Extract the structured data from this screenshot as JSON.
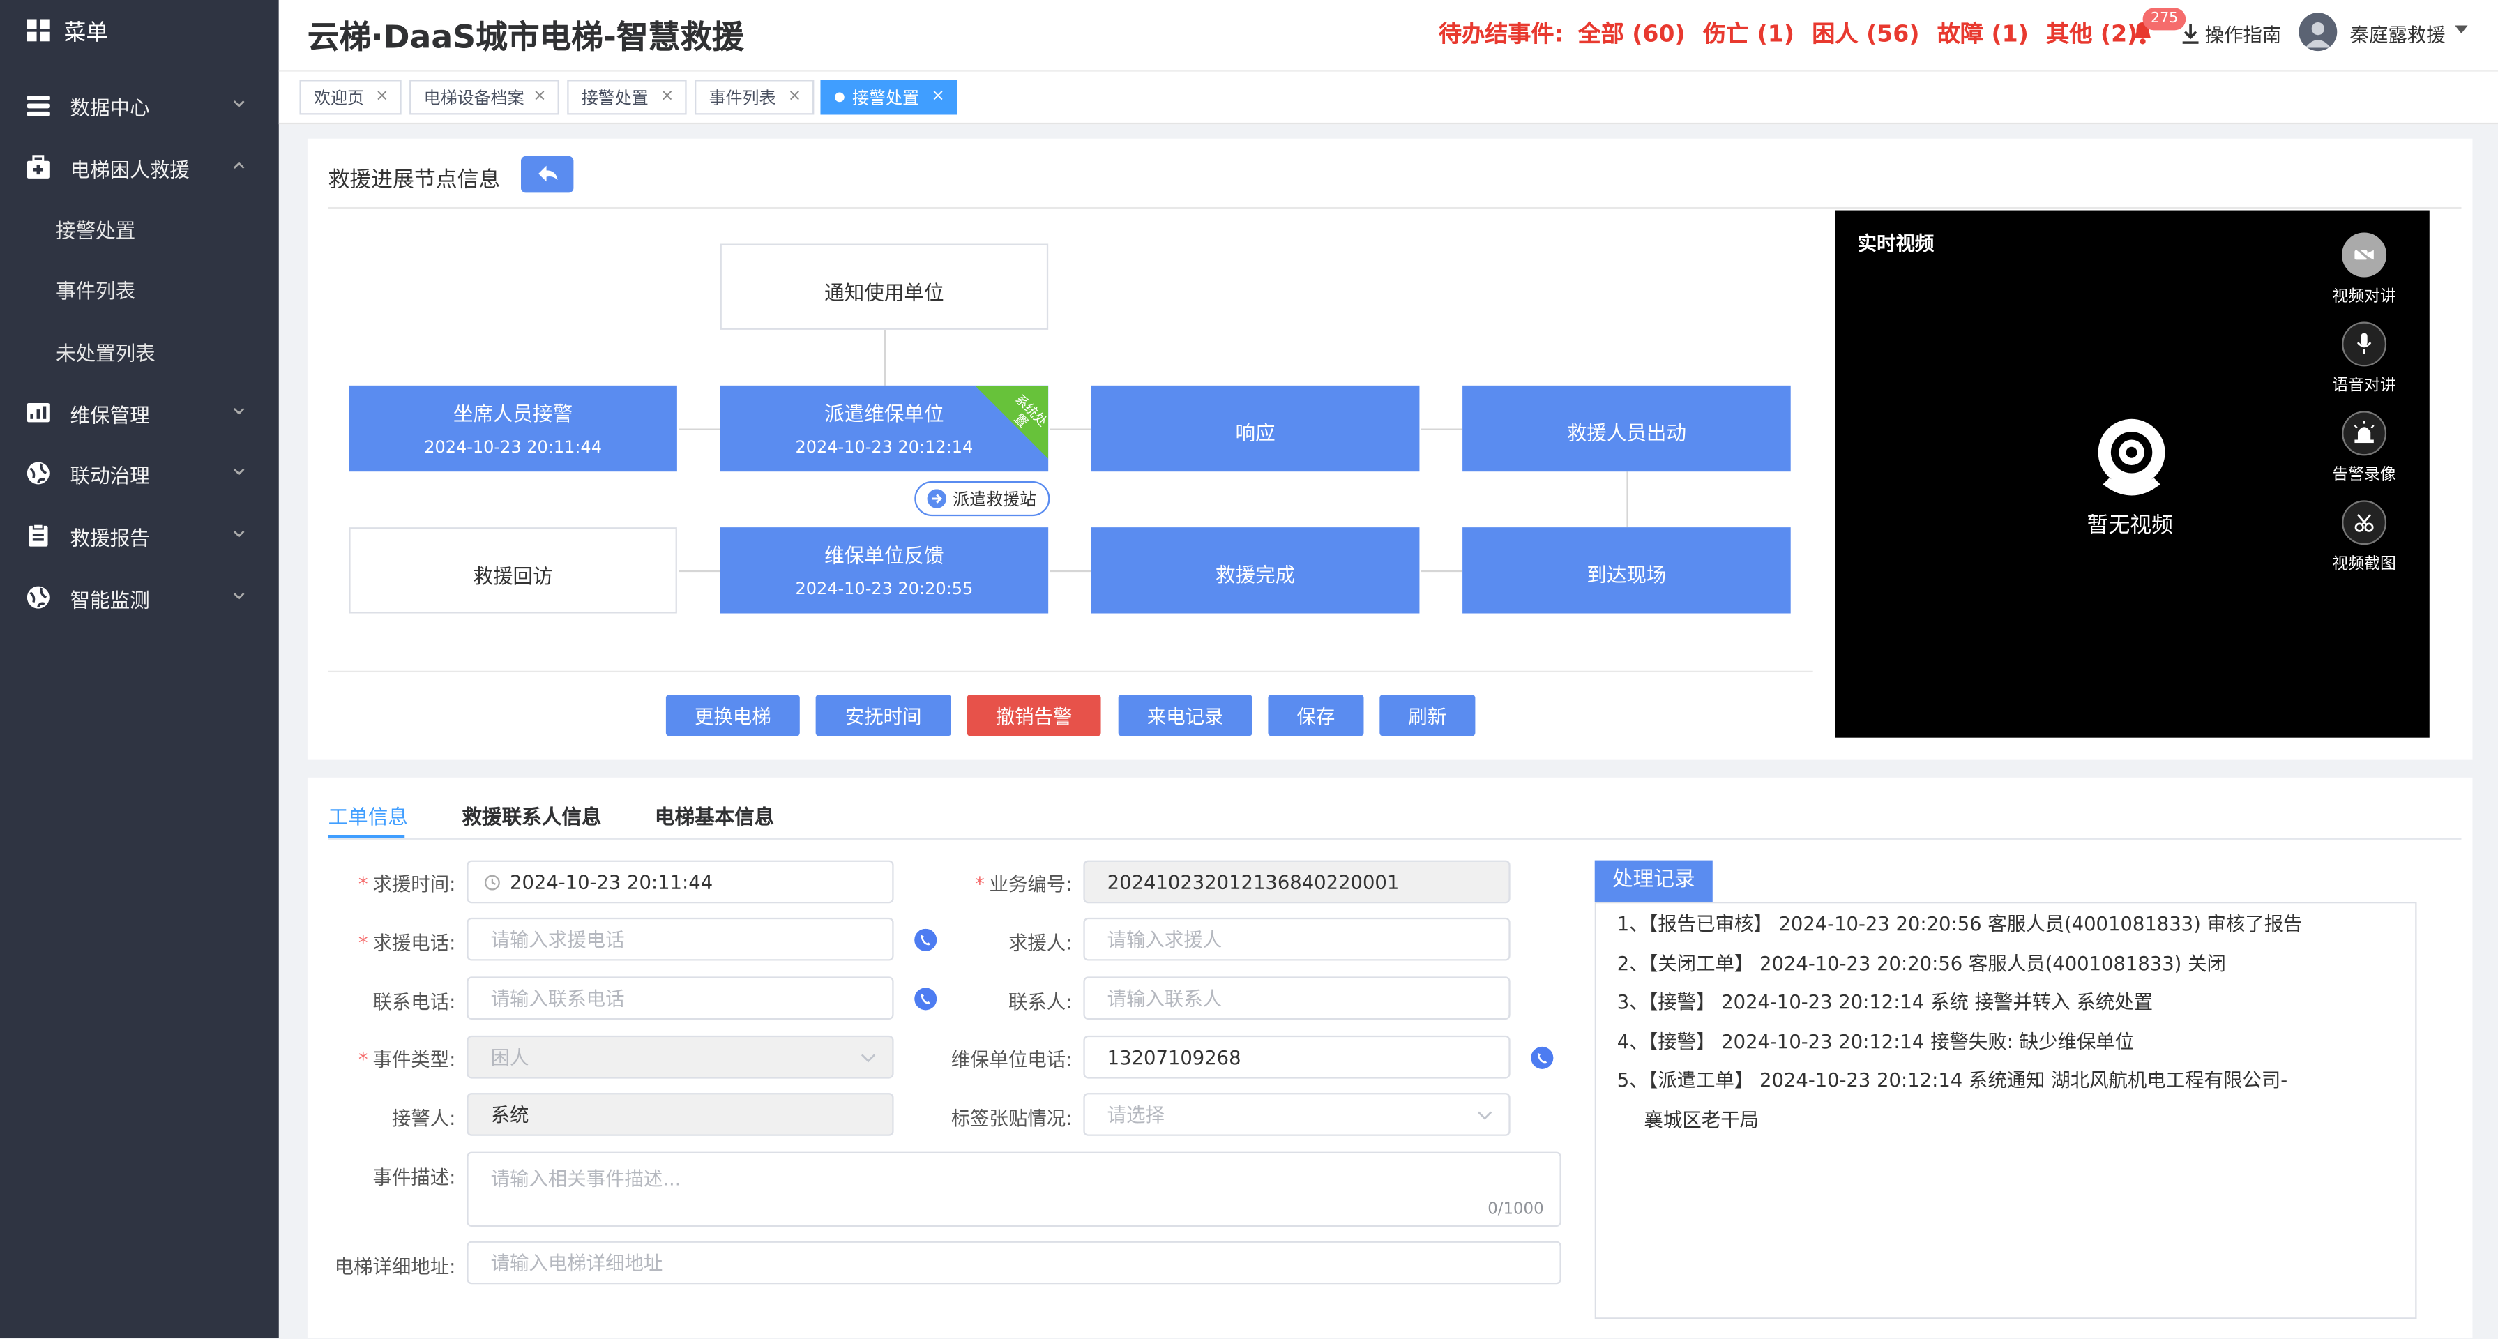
{
  "sidebar": {
    "title": "菜单",
    "items": [
      {
        "label": "数据中心",
        "icon": "database-icon"
      },
      {
        "label": "电梯困人救援",
        "icon": "medkit-icon",
        "children": [
          "接警处置",
          "事件列表",
          "未处置列表"
        ]
      },
      {
        "label": "维保管理",
        "icon": "maintenance-icon"
      },
      {
        "label": "联动治理",
        "icon": "globe-icon"
      },
      {
        "label": "救援报告",
        "icon": "report-icon"
      },
      {
        "label": "智能监测",
        "icon": "monitor-icon"
      }
    ]
  },
  "header": {
    "title": "云梯·DaaS城市电梯-智慧救援",
    "pending_label": "待办结事件:",
    "pending": [
      "全部 (60)",
      "伤亡 (1)",
      "困人 (56)",
      "故障 (1)",
      "其他 (2)"
    ],
    "bell_count": "275",
    "guide": "操作指南",
    "user": "秦庭露救援"
  },
  "tabs": [
    {
      "label": "欢迎页"
    },
    {
      "label": "电梯设备档案"
    },
    {
      "label": "接警处置"
    },
    {
      "label": "事件列表"
    },
    {
      "label": "接警处置",
      "active": true
    }
  ],
  "progress": {
    "title": "救援进展节点信息",
    "nodes": {
      "notify": {
        "label": "通知使用单位"
      },
      "seat": {
        "label": "坐席人员接警",
        "time": "2024-10-23 20:11:44"
      },
      "dispatch": {
        "label": "派遣维保单位",
        "time": "2024-10-23 20:12:14",
        "corner": "系统处置"
      },
      "respond": {
        "label": "响应"
      },
      "depart": {
        "label": "救援人员出动"
      },
      "revisit": {
        "label": "救援回访"
      },
      "feedback": {
        "label": "维保单位反馈",
        "time": "2024-10-23 20:20:55"
      },
      "complete": {
        "label": "救援完成"
      },
      "arrive": {
        "label": "到达现场"
      }
    },
    "dispatch_station": "派遣救援站"
  },
  "actions": [
    "更换电梯",
    "安抚时间",
    "撤销告警",
    "来电记录",
    "保存",
    "刷新"
  ],
  "video": {
    "title": "实时视频",
    "no_video": "暂无视频",
    "controls": [
      "视频对讲",
      "语音对讲",
      "告警录像",
      "视频截图"
    ]
  },
  "bottom_tabs": [
    "工单信息",
    "救援联系人信息",
    "电梯基本信息"
  ],
  "form": {
    "request_time": {
      "label": "求援时间:",
      "value": "2024-10-23 20:11:44"
    },
    "business_no": {
      "label": "业务编号:",
      "value": "20241023201213684022000​1"
    },
    "request_phone": {
      "label": "求援电话:",
      "placeholder": "请输入求援电话"
    },
    "requester": {
      "label": "求援人:",
      "placeholder": "请输入求援人"
    },
    "contact_phone": {
      "label": "联系电话:",
      "placeholder": "请输入联系电话"
    },
    "contact": {
      "label": "联系人:",
      "placeholder": "请输入联系人"
    },
    "event_type": {
      "label": "事件类型:",
      "value": "困人"
    },
    "maint_phone": {
      "label": "维保单位电话:",
      "value": "13207109268"
    },
    "receiver": {
      "label": "接警人:",
      "value": "系统"
    },
    "label_status": {
      "label": "标签张贴情况:",
      "placeholder": "请选择"
    },
    "description": {
      "label": "事件描述:",
      "placeholder": "请输入相关事件描述...",
      "counter": "0/1000"
    },
    "address": {
      "label": "电梯详细地址:",
      "placeholder": "请输入电梯详细地址"
    }
  },
  "records": {
    "title": "处理记录",
    "items": [
      "1、【报告已审核】 2024-10-23 20:20:56 客服人员(4001081833) 审核了报告",
      "2、【关闭工单】 2024-10-23 20:20:56 客服人员(4001081833) 关闭",
      "3、【接警】 2024-10-23 20:12:14 系统 接警并转入 系统处置",
      "4、【接警】 2024-10-23 20:12:14 接警失败: 缺少维保单位",
      "5、【派遣工单】 2024-10-23 20:12:14 系统通知 湖北风航机电工程有限公司-"
    ],
    "item5_cont": "襄城区老干局"
  },
  "colors": {
    "primary": "#5a8cf0",
    "danger": "#e7524a",
    "pending": "#e8392f",
    "sidebar": "#2f3442",
    "corner": "#67c23a"
  }
}
